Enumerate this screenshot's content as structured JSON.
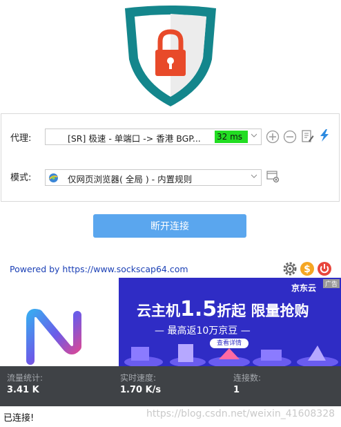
{
  "proxy": {
    "label": "代理:",
    "selected": "[SR] 极速 - 单端口 -> 香港 BGP...",
    "latency": "32 ms"
  },
  "mode": {
    "label": "模式:",
    "selected": "仅网页浏览器( 全局 ) - 内置规则"
  },
  "connect_button": "断开连接",
  "powered_by": "Powered by https://www.sockscap64.com",
  "ad": {
    "brand": "京东云",
    "tag": "广告",
    "title_prefix": "云主机",
    "title_number": "1.5",
    "title_suffix": "折起  限量抢购",
    "subtitle": "— 最高返10万京豆 —",
    "button": "查看详情"
  },
  "stats": {
    "traffic_label": "流量统计:",
    "traffic_value": "3.41 K",
    "speed_label": "实时速度:",
    "speed_value": "1.70 K/s",
    "connections_label": "连接数:",
    "connections_value": "1"
  },
  "status": "已连接!",
  "watermark": "https://blog.csdn.net/weixin_41608328",
  "colors": {
    "accent": "#5aa6ee",
    "latency_bg": "#22dd22",
    "shield_teal": "#14868c",
    "lock_red": "#e84a2a",
    "stats_bg": "#3f4246",
    "ad_bg": "#2f2cc5"
  }
}
